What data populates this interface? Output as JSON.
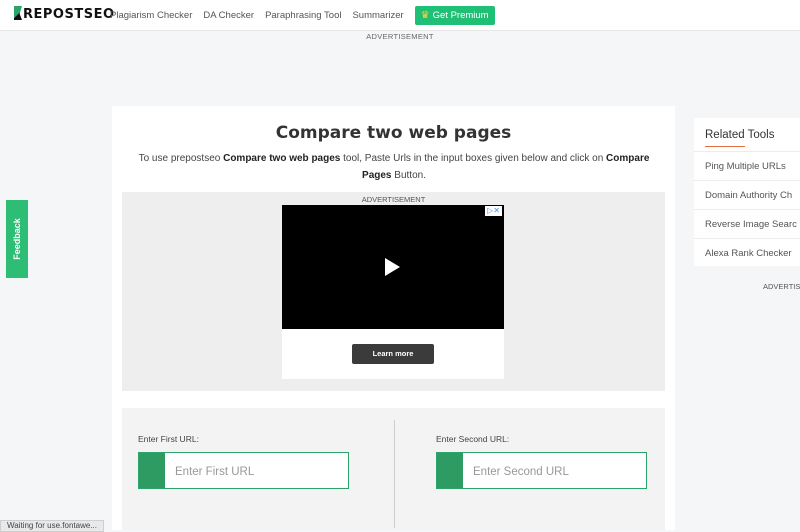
{
  "brand": {
    "logo_text": "REPOSTSEO"
  },
  "nav": {
    "items": [
      "Plagiarism Checker",
      "DA Checker",
      "Paraphrasing Tool",
      "Summarizer"
    ],
    "premium_label": "Get Premium"
  },
  "top_ad": {
    "label": "ADVERTISEMENT"
  },
  "main": {
    "title": "Compare two web pages",
    "desc_pre": "To use prepostseo ",
    "desc_tool": "Compare two web pages",
    "desc_mid": " tool, Paste Urls in the input boxes given below and click on ",
    "desc_button": "Compare Pages",
    "desc_post": " Button."
  },
  "ad": {
    "label": "ADVERTISEMENT",
    "cta": "Learn more",
    "choices": "▷✕"
  },
  "urls": {
    "first_label": "Enter First URL:",
    "first_placeholder": "Enter First URL",
    "second_label": "Enter Second URL:",
    "second_placeholder": "Enter Second URL"
  },
  "related": {
    "title": "Related Tools",
    "items": [
      "Ping Multiple URLs",
      "Domain Authority Ch",
      "Reverse Image Searc",
      "Alexa Rank Checker"
    ]
  },
  "side_ad": {
    "label": "ADVERTIS"
  },
  "feedback": {
    "label": "Feedback"
  },
  "status": {
    "text": "Waiting for use.fontawe..."
  },
  "colors": {
    "accent": "#1fbf75",
    "field_green": "#2e9b63",
    "underline": "#e07040"
  }
}
